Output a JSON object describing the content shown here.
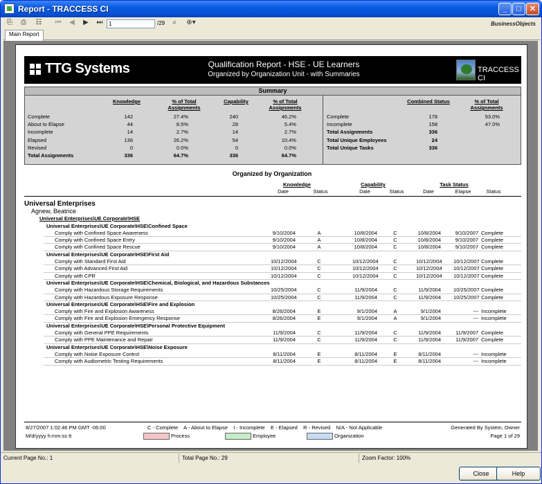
{
  "window": {
    "title": "Report - TRACCESS CI",
    "min": "_",
    "max": "□",
    "close": "✕"
  },
  "toolbar": {
    "page_value": "1",
    "page_total": "/29",
    "brand": "BusinessObjects"
  },
  "tabs": [
    {
      "label": "Main Report"
    }
  ],
  "report": {
    "logo": "TTG Systems",
    "title": "Qualification Report - HSE - UE Learners",
    "subtitle": "Organized by Organization Unit - with Summaries",
    "product": "TRACCESS CI",
    "summary": {
      "heading": "Summary",
      "left_headers": [
        "Knowledge",
        "% of Total Assignments",
        "Capability",
        "% of Total Assignments"
      ],
      "left_rows": [
        {
          "label": "Complete",
          "k": "142",
          "kp": "27.4%",
          "c": "240",
          "cp": "46.2%"
        },
        {
          "label": "About to Elapse",
          "k": "44",
          "kp": "8.5%",
          "c": "28",
          "cp": "5.4%"
        },
        {
          "label": "Incomplete",
          "k": "14",
          "kp": "2.7%",
          "c": "14",
          "cp": "2.7%"
        },
        {
          "label": "Elapsed",
          "k": "136",
          "kp": "26.2%",
          "c": "54",
          "cp": "10.4%"
        },
        {
          "label": "Revised",
          "k": "0",
          "kp": "0.0%",
          "c": "0",
          "cp": "0.0%"
        },
        {
          "label": "Total Assignments",
          "k": "336",
          "kp": "64.7%",
          "c": "336",
          "cp": "64.7%"
        }
      ],
      "right_headers": [
        "Combined Status",
        "% of Total Assignments"
      ],
      "right_rows": [
        {
          "label": "Complete",
          "v": "178",
          "p": "53.0%"
        },
        {
          "label": "Incomplete",
          "v": "158",
          "p": "47.0%"
        },
        {
          "label": "Total Assignments",
          "v": "336",
          "p": ""
        },
        {
          "label": "Total Unique Employees",
          "v": "24",
          "p": ""
        },
        {
          "label": "Total Unique Tasks",
          "v": "336",
          "p": ""
        }
      ]
    },
    "org_title": "Organized by Organization",
    "col_groups": [
      "Knowledge",
      "Capability",
      "Task Status"
    ],
    "col_heads": [
      "Date",
      "Status",
      "Date",
      "Status",
      "Date",
      "Elapse",
      "Status"
    ],
    "company": "Universal Enterprises",
    "person": "Agnew, Beatrice",
    "org": "Universal Enterprises\\UE Corporate\\HSE",
    "groups": [
      {
        "name": "Universal Enterprises\\UE Corporate\\HSE\\Confined Space",
        "rows": [
          [
            "Comply with Confined Space Awareness",
            "9/10/2004",
            "A",
            "10/8/2004",
            "C",
            "10/8/2004",
            "9/10/2007",
            "Complete"
          ],
          [
            "Comply with Confined Space Entry",
            "9/10/2004",
            "A",
            "10/8/2004",
            "C",
            "10/8/2004",
            "9/10/2007",
            "Complete"
          ],
          [
            "Comply with Confined Space Rescue",
            "9/10/2004",
            "A",
            "10/8/2004",
            "C",
            "10/8/2004",
            "9/10/2007",
            "Complete"
          ]
        ]
      },
      {
        "name": "Universal Enterprises\\UE Corporate\\HSE\\First Aid",
        "rows": [
          [
            "Comply with Standard First Aid",
            "10/12/2004",
            "C",
            "10/12/2004",
            "C",
            "10/12/2004",
            "10/12/2007",
            "Complete"
          ],
          [
            "Comply with Advanced First Aid",
            "10/12/2004",
            "C",
            "10/12/2004",
            "C",
            "10/12/2004",
            "10/12/2007",
            "Complete"
          ],
          [
            "Comply with CPR",
            "10/12/2004",
            "C",
            "10/12/2004",
            "C",
            "10/12/2004",
            "10/12/2007",
            "Complete"
          ]
        ]
      },
      {
        "name": "Universal Enterprises\\UE Corporate\\HSE\\Chemical, Biological, and Hazardous Substances",
        "rows": [
          [
            "Comply with Hazardous Storage Requirements",
            "10/25/2004",
            "C",
            "11/9/2004",
            "C",
            "11/9/2004",
            "10/25/2007",
            "Complete"
          ],
          [
            "Comply with Hazardous Exposure Response",
            "10/25/2004",
            "C",
            "11/9/2004",
            "C",
            "11/9/2004",
            "10/25/2007",
            "Complete"
          ]
        ]
      },
      {
        "name": "Universal Enterprises\\UE Corporate\\HSE\\Fire and Explosion",
        "rows": [
          [
            "Comply with Fire and Explosion Awareness",
            "8/26/2004",
            "E",
            "9/1/2004",
            "A",
            "9/1/2004",
            "---",
            "Incomplete"
          ],
          [
            "Comply with Fire and Explosion Emergency Response",
            "8/26/2004",
            "E",
            "9/1/2004",
            "A",
            "9/1/2004",
            "---",
            "Incomplete"
          ]
        ]
      },
      {
        "name": "Universal Enterprises\\UE Corporate\\HSE\\Personal Protective Equipment",
        "rows": [
          [
            "Comply with General PPE Requirements",
            "11/9/2004",
            "C",
            "11/9/2004",
            "C",
            "11/9/2004",
            "11/9/2007",
            "Complete"
          ],
          [
            "Comply with PPE Maintenance and Repair",
            "11/9/2004",
            "C",
            "11/9/2004",
            "C",
            "11/9/2004",
            "11/9/2007",
            "Complete"
          ]
        ]
      },
      {
        "name": "Universal Enterprises\\UE Corporate\\HSE\\Noise Exposure",
        "rows": [
          [
            "Comply with Noise Exposure Control",
            "8/11/2004",
            "E",
            "8/11/2004",
            "E",
            "8/11/2004",
            "---",
            "Incomplete"
          ],
          [
            "Comply with Audiometric Testing Requirements",
            "8/11/2004",
            "E",
            "8/11/2004",
            "E",
            "8/11/2004",
            "---",
            "Incomplete"
          ]
        ]
      }
    ],
    "footer": {
      "timestamp": "8/27/2007  1:02:46 PM GMT -06:00",
      "format": "M/d/yyyy h:mm:ss tt",
      "legend": "C - Complete    A - About to Elapse    I - Incomplete    E - Elapsed    R - Revised    N/A - Not Applicable",
      "generated": "Generated By System, Owner",
      "page": "Page 1 of 29",
      "sw": [
        {
          "label": "Process",
          "color": "#f4c6c6"
        },
        {
          "label": "Employee",
          "color": "#c6ecc6"
        },
        {
          "label": "Organization",
          "color": "#c6dcf4"
        }
      ]
    }
  },
  "status": {
    "current": "Current Page No.: 1",
    "total": "Total Page No.: 29",
    "zoom": "Zoom Factor: 100%"
  },
  "buttons": {
    "close": "Close",
    "help": "Help"
  }
}
